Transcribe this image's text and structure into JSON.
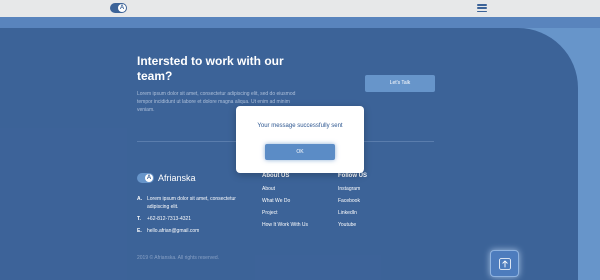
{
  "header": {
    "logo_letter": "A",
    "menu_icon": "hamburger-icon"
  },
  "cta": {
    "title": "Intersted to work with our team?",
    "text": "Lorem ipsum dolor sit amet, consectetur adipiscing elit, sed do eiusmod tempor incididunt ut labore et dolore magna aliqua. Ut enim ad minim veniam.",
    "button_label": "Let's Talk"
  },
  "brand": {
    "logo_letter": "A",
    "name": "Afrianska"
  },
  "contact": [
    {
      "key": "A.",
      "value": "Lorem ipsum dolor sit amet, consectetur adipiscing elit."
    },
    {
      "key": "T.",
      "value": "+62-812-7313-4321"
    },
    {
      "key": "E.",
      "value": "hello.afrian@gmail.com"
    }
  ],
  "about": {
    "heading": "About US",
    "links": [
      "About",
      "What We Do",
      "Project",
      "How It Work With Us"
    ]
  },
  "follow": {
    "heading": "Follow US",
    "links": [
      "Instagram",
      "Facebook",
      "LinkedIn",
      "Youtube"
    ]
  },
  "copyright": "2019 © Afrianska. All rights reserved.",
  "modal": {
    "message": "Your message successfully sent",
    "ok_label": "OK"
  },
  "back_to_top_icon": "arrow-up-icon",
  "colors": {
    "primary": "#2c5690",
    "accent": "#5b8cc6",
    "topbar": "#e5e6e8"
  }
}
